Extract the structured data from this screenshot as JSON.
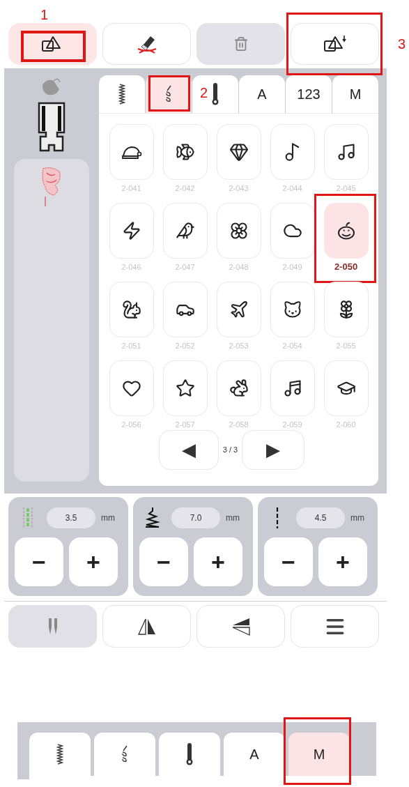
{
  "callouts": [
    {
      "number": "1"
    },
    {
      "number": "2"
    },
    {
      "number": "3"
    }
  ],
  "top_buttons": [
    {
      "kind": "layers",
      "selected": true,
      "disabled": false,
      "highlighted": true
    },
    {
      "kind": "eraser",
      "selected": false,
      "disabled": false,
      "highlighted": false
    },
    {
      "kind": "trash",
      "selected": false,
      "disabled": true,
      "highlighted": false
    },
    {
      "kind": "layers-down",
      "selected": false,
      "disabled": false,
      "highlighted": true
    }
  ],
  "tabs": [
    {
      "kind": "zigzag",
      "selected": false,
      "highlighted": false
    },
    {
      "kind": "decorative",
      "selected": true,
      "highlighted": true
    },
    {
      "kind": "buttonhole",
      "selected": false,
      "highlighted": false
    },
    {
      "kind": "text",
      "label": "A",
      "selected": false,
      "highlighted": false
    },
    {
      "kind": "text",
      "label": "123",
      "selected": false,
      "highlighted": false
    },
    {
      "kind": "text",
      "label": "M",
      "selected": false,
      "highlighted": false
    }
  ],
  "stitches": [
    {
      "label": "2-041",
      "selected": false,
      "highlighted": false
    },
    {
      "label": "2-042",
      "selected": false,
      "highlighted": false
    },
    {
      "label": "2-043",
      "selected": false,
      "highlighted": false
    },
    {
      "label": "2-044",
      "selected": false,
      "highlighted": false
    },
    {
      "label": "2-045",
      "selected": false,
      "highlighted": false
    },
    {
      "label": "2-046",
      "selected": false,
      "highlighted": false
    },
    {
      "label": "2-047",
      "selected": false,
      "highlighted": false
    },
    {
      "label": "2-048",
      "selected": false,
      "highlighted": false
    },
    {
      "label": "2-049",
      "selected": false,
      "highlighted": false
    },
    {
      "label": "2-050",
      "selected": true,
      "highlighted": true
    },
    {
      "label": "2-051",
      "selected": false,
      "highlighted": false
    },
    {
      "label": "2-052",
      "selected": false,
      "highlighted": false
    },
    {
      "label": "2-053",
      "selected": false,
      "highlighted": false
    },
    {
      "label": "2-054",
      "selected": false,
      "highlighted": false
    },
    {
      "label": "2-055",
      "selected": false,
      "highlighted": false
    },
    {
      "label": "2-056",
      "selected": false,
      "highlighted": false
    },
    {
      "label": "2-057",
      "selected": false,
      "highlighted": false
    },
    {
      "label": "2-058",
      "selected": false,
      "highlighted": false
    },
    {
      "label": "2-059",
      "selected": false,
      "highlighted": false
    },
    {
      "label": "2-060",
      "selected": false,
      "highlighted": false
    }
  ],
  "pager": {
    "previous": "◀",
    "page": "3 / 3",
    "next": "▶"
  },
  "settings": [
    {
      "kind": "width",
      "value": "3.5",
      "unit": "mm",
      "minus": "−",
      "plus": "+"
    },
    {
      "kind": "length",
      "value": "7.0",
      "unit": "mm",
      "minus": "−",
      "plus": "+"
    },
    {
      "kind": "density",
      "value": "4.5",
      "unit": "mm",
      "minus": "−",
      "plus": "+"
    }
  ],
  "bottom_buttons": [
    {
      "kind": "twin-needle",
      "disabled": true
    },
    {
      "kind": "mirror-horizontal",
      "disabled": false
    },
    {
      "kind": "mirror-vertical",
      "disabled": false
    },
    {
      "kind": "menu",
      "disabled": false
    }
  ],
  "lower_tabs": [
    {
      "kind": "zigzag",
      "selected": false,
      "highlighted": false
    },
    {
      "kind": "decorative",
      "selected": false,
      "highlighted": false
    },
    {
      "kind": "buttonhole",
      "selected": false,
      "highlighted": false
    },
    {
      "kind": "text",
      "label": "A",
      "selected": false,
      "highlighted": false
    },
    {
      "kind": "text",
      "label": "M",
      "selected": true,
      "highlighted": true
    }
  ]
}
